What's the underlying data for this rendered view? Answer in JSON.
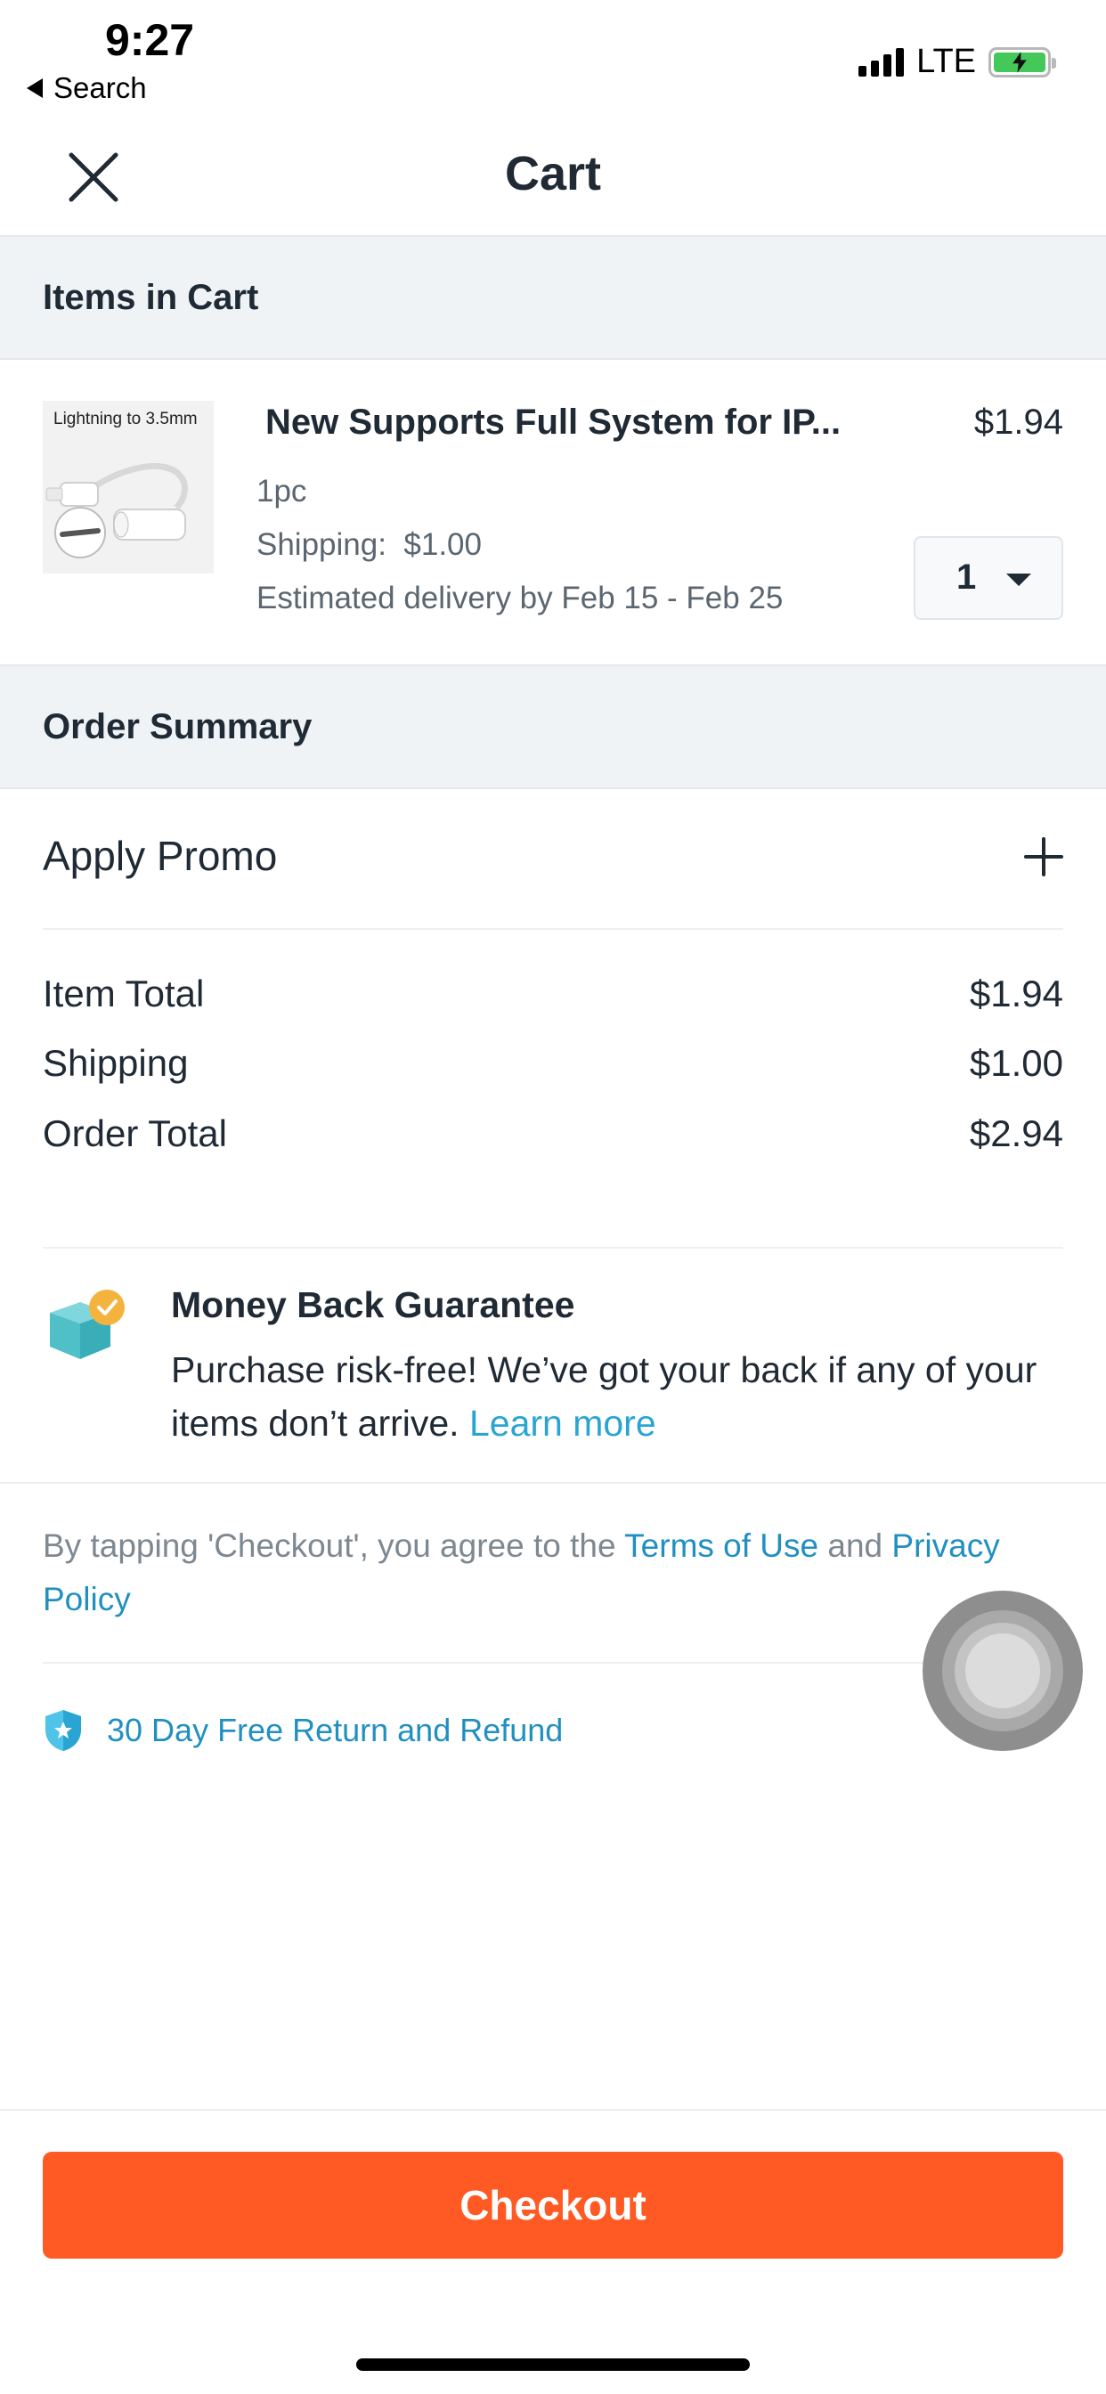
{
  "status_bar": {
    "time": "9:27",
    "back_label": "Search",
    "network": "LTE"
  },
  "header": {
    "title": "Cart"
  },
  "items_section": {
    "title": "Items in Cart"
  },
  "cart_item": {
    "image_caption": "Lightning to 3.5mm",
    "name": "New Supports Full System for IP...",
    "price": "$1.94",
    "variant": "1pc",
    "shipping_label": "Shipping:",
    "shipping_value": "$1.00",
    "delivery": "Estimated delivery by Feb 15 - Feb 25",
    "quantity": "1"
  },
  "summary_section": {
    "title": "Order Summary",
    "promo_label": "Apply Promo",
    "rows": [
      {
        "label": "Item Total",
        "value": "$1.94"
      },
      {
        "label": "Shipping",
        "value": "$1.00"
      },
      {
        "label": "Order Total",
        "value": "$2.94"
      }
    ]
  },
  "guarantee": {
    "title": "Money Back Guarantee",
    "text": "Purchase risk-free! We’ve got your back if any of your items don’t arrive.",
    "link": "Learn more"
  },
  "legal": {
    "prefix": "By tapping 'Checkout', you agree to the",
    "terms_link": "Terms of Use",
    "conjunction": "and",
    "privacy_link": "Privacy Policy"
  },
  "refund": {
    "label": "30 Day Free Return and Refund"
  },
  "checkout": {
    "label": "Checkout",
    "color": "#ff5a24"
  },
  "colors": {
    "accent_link": "#2190c1",
    "section_bg": "#eff3f6"
  },
  "icons": [
    "close-icon",
    "plus-icon",
    "shield-icon",
    "box-icon",
    "dropdown-caret-icon"
  ]
}
